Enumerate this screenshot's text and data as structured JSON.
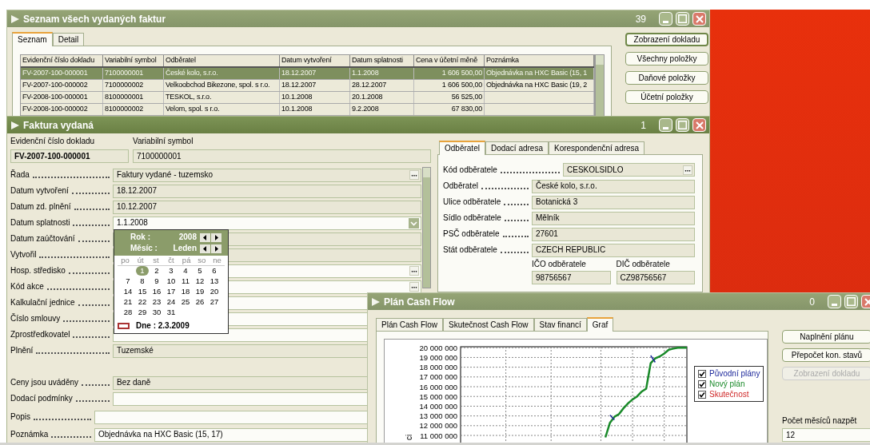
{
  "invoice_list": {
    "title": "Seznam všech vydaných faktur",
    "count": "39",
    "active": false,
    "tabs": [
      {
        "label": "Seznam",
        "selected": true
      },
      {
        "label": "Detail",
        "selected": false
      }
    ],
    "table": {
      "columns": [
        "Evidenční číslo dokladu",
        "Variabilní symbol",
        "Odběratel",
        "Datum vytvoření",
        "Datum splatnosti",
        "Cena v účetní měně",
        "Poznámka"
      ],
      "rows": [
        {
          "selected": true,
          "cells": [
            "FV-2007-100-000001",
            "7100000001",
            "České kolo, s.r.o.",
            "18.12.2007",
            "1.1.2008",
            "1 606 500,00",
            "Objednávka na HXC Basic (15, 1"
          ]
        },
        {
          "selected": false,
          "cells": [
            "FV-2007-100-000002",
            "7100000002",
            "Velkoobchod Bikezone, spol. s r.o.",
            "18.12.2007",
            "28.12.2007",
            "1 606 500,00",
            "Objednávka na HXC Basic (19, 2"
          ]
        },
        {
          "selected": false,
          "cells": [
            "FV-2008-100-000001",
            "8100000001",
            "TESKOL, s.r.o.",
            "10.1.2008",
            "20.1.2008",
            "56 525,00",
            ""
          ]
        },
        {
          "selected": false,
          "cells": [
            "FV-2008-100-000002",
            "8100000002",
            "Velom, spol. s r.o.",
            "10.1.2008",
            "9.2.2008",
            "67 830,00",
            ""
          ]
        }
      ]
    },
    "buttons": [
      {
        "label": "Zobrazení dokladu",
        "default": true
      },
      {
        "label": "Všechny položky",
        "default": false
      },
      {
        "label": "Daňové položky",
        "default": false
      },
      {
        "label": "Účetní položky",
        "default": false
      }
    ]
  },
  "invoice_form": {
    "title": "Faktura vydaná",
    "count": "1",
    "active": true,
    "header": [
      {
        "label": "Evidenční číslo dokladu",
        "value": "FV-2007-100-000001",
        "bold": true
      },
      {
        "label": "Variabilní symbol",
        "value": "7100000001",
        "bold": false
      }
    ],
    "sections": [
      [
        {
          "label": "Řada",
          "value": "Faktury vydané - tuzemsko",
          "kind": "lookup"
        },
        {
          "label": "Datum vytvoření",
          "value": "18.12.2007",
          "kind": "readonly"
        },
        {
          "label": "Datum zd. plnění",
          "value": "10.12.2007",
          "kind": "readonly"
        },
        {
          "label": "Datum splatnosti",
          "value": "1.1.2008",
          "kind": "dropdown"
        },
        {
          "label": "Datum zaúčtování",
          "kind": "readonly"
        },
        {
          "label": "Vytvořil",
          "kind": "readonly"
        },
        {
          "label": "Hosp. středisko",
          "kind": "lookup_input"
        },
        {
          "label": "Kód akce",
          "kind": "lookup_input"
        },
        {
          "label": "Kalkulační jednice",
          "kind": "input"
        },
        {
          "label": "Číslo smlouvy",
          "kind": "input"
        },
        {
          "label": "Zprostředkovatel",
          "kind": "input"
        },
        {
          "label": "Plnění",
          "value": "Tuzemské",
          "kind": "readonly"
        }
      ],
      [
        {
          "label": "Ceny jsou uváděny",
          "value": "Bez daně",
          "kind": "readonly"
        },
        {
          "label": "Dodací podmínky",
          "kind": "input"
        }
      ],
      [
        {
          "label": "Popis",
          "kind": "wide"
        },
        {
          "label": "Poznámka",
          "value": "Objednávka na HXC Basic (15, 17)",
          "kind": "wide"
        }
      ]
    ],
    "calendar": {
      "year_label": "Rok :",
      "year": "2008",
      "month_label": "Měsíc :",
      "month": "Leden",
      "weekdays": [
        "po",
        "út",
        "st",
        "čt",
        "pá",
        "so",
        "ne"
      ],
      "weeks": [
        [
          {
            "label": "1",
            "selected": true
          },
          {
            "label": "2",
            "selected": false
          },
          {
            "label": "3",
            "selected": false
          },
          {
            "label": "4",
            "selected": false
          },
          {
            "label": "5",
            "selected": false
          },
          {
            "label": "6",
            "selected": false
          }
        ],
        [
          {
            "label": "7",
            "selected": false
          },
          {
            "label": "8",
            "selected": false
          },
          {
            "label": "9",
            "selected": false
          },
          {
            "label": "10",
            "selected": false
          },
          {
            "label": "11",
            "selected": false
          },
          {
            "label": "12",
            "selected": false
          },
          {
            "label": "13",
            "selected": false
          }
        ],
        [
          {
            "label": "14",
            "selected": false
          },
          {
            "label": "15",
            "selected": false
          },
          {
            "label": "16",
            "selected": false
          },
          {
            "label": "17",
            "selected": false
          },
          {
            "label": "18",
            "selected": false
          },
          {
            "label": "19",
            "selected": false
          },
          {
            "label": "20",
            "selected": false
          }
        ],
        [
          {
            "label": "21",
            "selected": false
          },
          {
            "label": "22",
            "selected": false
          },
          {
            "label": "23",
            "selected": false
          },
          {
            "label": "24",
            "selected": false
          },
          {
            "label": "25",
            "selected": false
          },
          {
            "label": "26",
            "selected": false
          },
          {
            "label": "27",
            "selected": false
          }
        ],
        [
          {
            "label": "28",
            "selected": false
          },
          {
            "label": "29",
            "selected": false
          },
          {
            "label": "30",
            "selected": false
          },
          {
            "label": "31",
            "selected": false
          }
        ]
      ],
      "today": "Dne : 2.3.2009"
    },
    "customer": {
      "tabs": [
        {
          "label": "Odběratel",
          "selected": true
        },
        {
          "label": "Dodací adresa",
          "selected": false
        },
        {
          "label": "Korespondenční adresa",
          "selected": false
        }
      ],
      "code": {
        "label": "Kód odběratele",
        "value": "CESKOLSIDLO"
      },
      "fields": [
        {
          "label": "Odběratel",
          "value": "České kolo, s.r.o."
        },
        {
          "label": "Ulice odběratele",
          "value": "Botanická 3"
        },
        {
          "label": "Sídlo odběratele",
          "value": "Mělník"
        },
        {
          "label": "PSČ odběratele",
          "value": "27601"
        },
        {
          "label": "Stát odběratele",
          "value": "CZECH REPUBLIC"
        }
      ],
      "ids": [
        {
          "label": "IČO odběratele",
          "value": "98756567"
        },
        {
          "label": "DIČ odběratele",
          "value": "CZ98756567"
        }
      ]
    }
  },
  "cash_flow": {
    "title": "Plán Cash Flow",
    "count": "0",
    "active": false,
    "tabs": [
      {
        "label": "Plán Cash Flow",
        "selected": false
      },
      {
        "label": "Skutečnost Cash Flow",
        "selected": false
      },
      {
        "label": "Stav financí",
        "selected": false
      },
      {
        "label": "Graf",
        "selected": true
      }
    ],
    "chart_data": {
      "type": "line",
      "ylabel": "ci",
      "ylim": [
        10000000,
        20100000
      ],
      "grid": true,
      "categories": [
        null,
        null,
        null,
        null,
        null,
        null,
        null,
        null,
        null,
        null,
        null,
        null,
        null,
        null,
        null,
        null,
        null,
        null,
        null,
        null,
        null,
        null,
        null,
        null,
        null,
        null,
        null,
        null,
        null,
        null,
        null,
        null,
        null,
        null,
        null,
        null,
        null,
        null,
        null,
        null,
        null,
        null,
        null,
        null,
        null,
        null,
        null,
        null,
        null,
        null,
        null
      ],
      "yticks": [
        {
          "value": 20000000,
          "label": "20 000 000"
        },
        {
          "value": 19000000,
          "label": "19 000 000"
        },
        {
          "value": 18000000,
          "label": "18 000 000"
        },
        {
          "value": 17000000,
          "label": "17 000 000"
        },
        {
          "value": 16000000,
          "label": "16 000 000"
        },
        {
          "value": 15000000,
          "label": "15 000 000"
        },
        {
          "value": 14000000,
          "label": "14 000 000"
        },
        {
          "value": 13000000,
          "label": "13 000 000"
        },
        {
          "value": 12000000,
          "label": "12 000 000"
        },
        {
          "value": 11000000,
          "label": "11 000 000"
        }
      ],
      "series": [
        {
          "name": "Původní plány",
          "color": "#1f2a9c",
          "values": [
            null,
            null,
            null,
            null,
            null,
            null,
            null,
            null,
            null,
            null,
            null,
            null,
            null,
            null,
            null,
            null,
            null,
            null,
            null,
            null,
            null,
            null,
            null,
            null,
            null,
            null,
            null,
            null,
            null,
            null,
            null,
            null,
            null,
            13100000,
            12600000,
            null,
            null,
            null,
            null,
            null,
            null,
            null,
            19200000,
            18500000,
            null,
            null,
            null,
            null,
            null,
            null,
            null
          ]
        },
        {
          "name": "Nový plán",
          "color": "#1a8a2a",
          "values": [
            null,
            null,
            null,
            null,
            null,
            null,
            null,
            null,
            null,
            null,
            null,
            null,
            null,
            null,
            null,
            null,
            null,
            null,
            null,
            null,
            null,
            null,
            null,
            null,
            null,
            null,
            null,
            null,
            null,
            null,
            null,
            null,
            10800000,
            12300000,
            12900000,
            13200000,
            13800000,
            14300000,
            14700000,
            15000000,
            15500000,
            15800000,
            18400000,
            18900000,
            19100000,
            19400000,
            19800000,
            19900000,
            20000000,
            20000000,
            20000000
          ]
        },
        {
          "name": "Skutečnost",
          "color": "#d02a2a",
          "values": [
            null,
            null,
            null,
            null,
            null,
            null,
            null,
            null,
            null,
            null,
            null,
            null,
            null,
            null,
            null,
            null,
            null,
            null,
            null,
            null,
            null,
            null,
            null,
            null,
            null,
            null,
            null,
            null,
            null,
            null,
            null,
            null,
            null,
            null,
            null,
            null,
            null,
            null,
            null,
            null,
            null,
            null,
            null,
            null,
            null,
            null,
            null,
            null,
            null,
            null,
            null
          ]
        }
      ]
    },
    "legend_checkboxes": [
      {
        "checked": true
      },
      {
        "checked": true
      },
      {
        "checked": true
      }
    ],
    "buttons": [
      {
        "label": "Naplnění plánu",
        "disabled": false
      },
      {
        "label": "Přepočet kon. stavů",
        "disabled": false
      },
      {
        "label": "Zobrazení dokladu",
        "disabled": true
      }
    ],
    "months_back": {
      "label": "Počet měsíců nazpět",
      "value": "12"
    }
  }
}
